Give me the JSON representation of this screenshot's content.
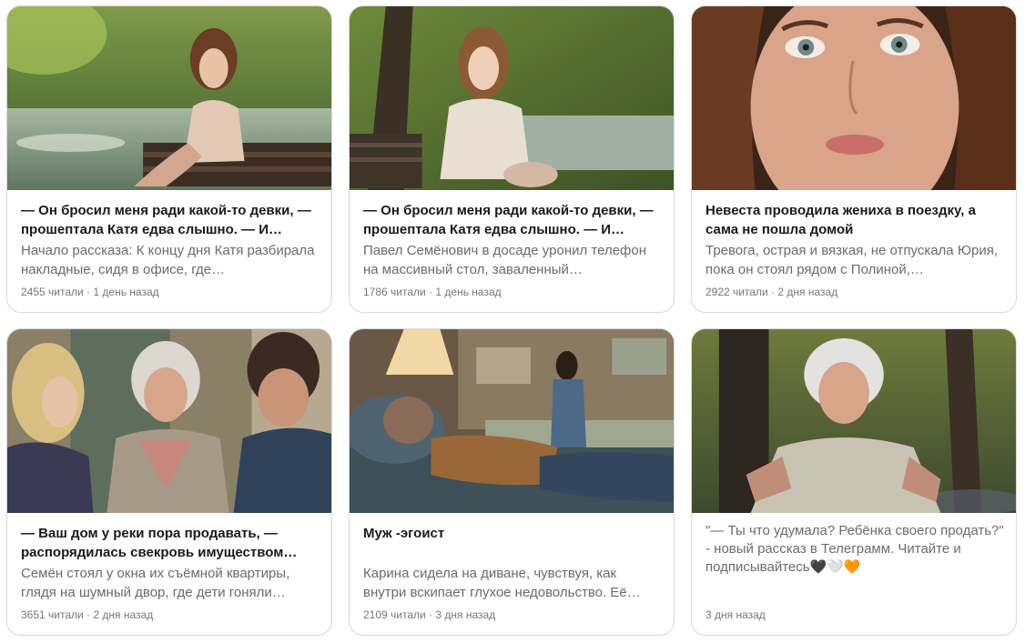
{
  "cards": [
    {
      "title": "— Он бросил меня ради какой-то девки, — прошептала Катя едва слышно. — И…",
      "snippet": "Начало рассказа: К концу дня Катя разбирала накладные, сидя в офисе, где…",
      "meta": "2455 читали · 1 день назад",
      "image": "woman-on-bench-by-lake"
    },
    {
      "title": "— Он бросил меня ради какой-то девки, — прошептала Катя едва слышно. — И…",
      "snippet": "Павел Семёнович в досаде уронил телефон на массивный стол, заваленный…",
      "meta": "1786 читали · 1 день назад",
      "image": "sad-woman-on-bench-in-park"
    },
    {
      "title": "Невеста проводила жениха в поездку, а сама не пошла домой",
      "snippet": "Тревога, острая и вязкая, не отпускала Юрия, пока он стоял рядом с Полиной,…",
      "meta": "2922 читали · 2 дня назад",
      "image": "woman-face-closeup"
    },
    {
      "title": "— Ваш дом у реки пора продавать, — распорядилась свекровь имуществом…",
      "snippet": "Семён стоял у окна их съёмной квартиры, глядя на шумный двор, где дети гоняли…",
      "meta": "3651 читали · 2 дня назад",
      "image": "family-argument-indoors"
    },
    {
      "title": "Муж -эгоист",
      "snippet": "Карина сидела на диване, чувствуя, как внутри вскипает глухое недовольство. Её мысли, словно заевшая пластинка,…",
      "meta": "2109 читали · 3 дня назад",
      "image": "man-lying-on-sofa"
    },
    {
      "title": "",
      "snippet": "\"— Ты что удумала? Ребёнка своего продать?\" - новый рассказ в Телеграмм. Читайте и подписывайтесь🖤🤍🧡",
      "meta": "3 дня назад",
      "image": "elderly-woman-in-park"
    }
  ],
  "colors": {
    "border": "#d9d9d9",
    "title": "#1a1a1a",
    "snippet": "#6b6b6b",
    "meta": "#777777"
  }
}
